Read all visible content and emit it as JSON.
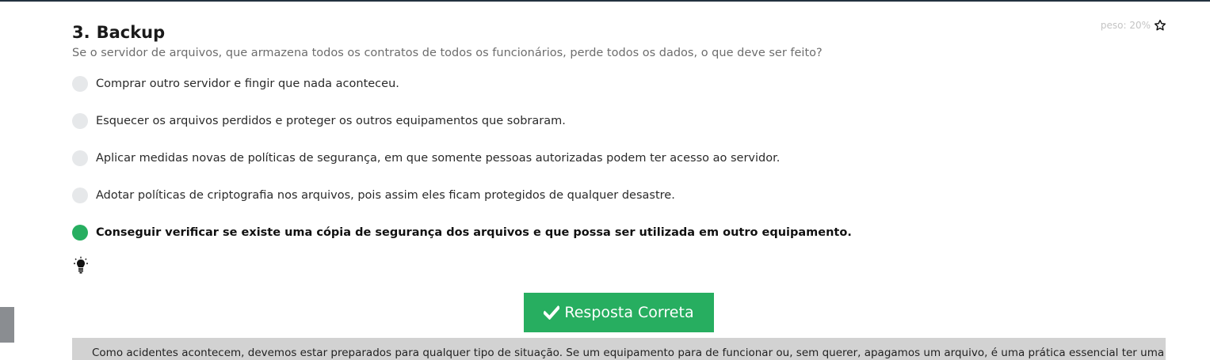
{
  "question": {
    "number": "3.",
    "title": "Backup",
    "weight_label": "peso: 20%",
    "text": "Se o servidor de arquivos, que armazena todos os contratos de todos os funcionários, perde todos os dados, o que deve ser feito?"
  },
  "options": [
    {
      "label": "Comprar outro servidor e fingir que nada aconteceu.",
      "selected": false
    },
    {
      "label": "Esquecer os arquivos perdidos e proteger os outros equipamentos que sobraram.",
      "selected": false
    },
    {
      "label": "Aplicar medidas novas de políticas de segurança, em que somente pessoas autorizadas podem ter acesso ao servidor.",
      "selected": false
    },
    {
      "label": "Adotar políticas de criptografia nos arquivos, pois assim eles ficam protegidos de qualquer desastre.",
      "selected": false
    },
    {
      "label": "Conseguir verificar se existe uma cópia de segurança dos arquivos e que possa ser utilizada em outro equipamento.",
      "selected": true
    }
  ],
  "result": {
    "label": "Resposta Correta"
  },
  "explanation": {
    "text": "Como acidentes acontecem, devemos estar preparados para qualquer tipo de situação. Se um equipamento para de funcionar ou, sem querer, apagamos um arquivo, é uma prática essencial ter uma"
  },
  "colors": {
    "accent": "#27ae60",
    "top_border": "#23323f",
    "radio_unselected": "#e6e8ea",
    "explanation_bg": "#d2d2d2"
  },
  "icons": {
    "weight": "star-outline-icon",
    "hint": "lightbulb-icon",
    "result": "check-icon"
  }
}
